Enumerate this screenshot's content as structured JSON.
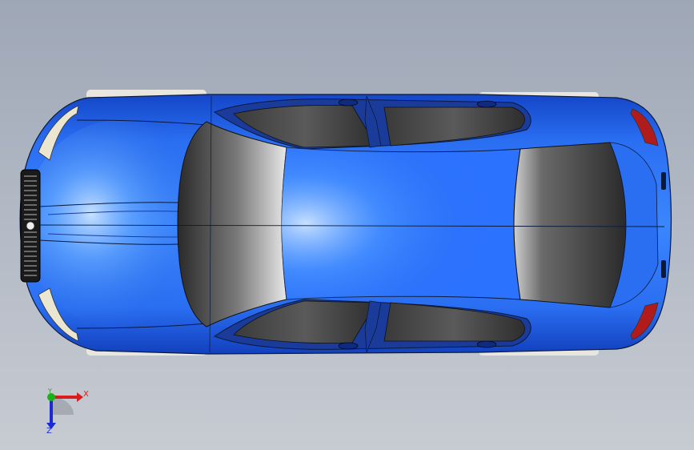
{
  "viewport": {
    "background_top": "#9ea7b6",
    "background_bottom": "#c7cbd2"
  },
  "model": {
    "part": "car-body",
    "view": "top",
    "body_color": "#1f5fe0",
    "glass_color": "#2b2b2b",
    "light_color": "#b01c1c"
  },
  "triad": {
    "x_label": "X",
    "y_label": "Y",
    "z_label": "Z",
    "x_color": "#d91c1c",
    "y_color": "#19b219",
    "z_color": "#1a2bd6"
  }
}
